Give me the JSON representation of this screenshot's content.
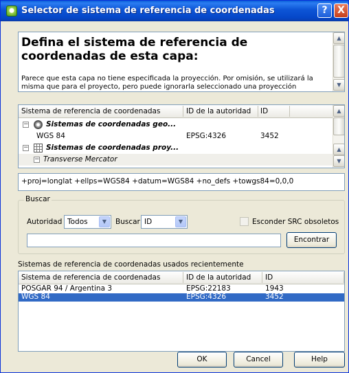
{
  "window": {
    "title": "Selector de sistema de referencia de coordenadas",
    "help_button": "?",
    "close_button": "X"
  },
  "header": {
    "title": "Defina el sistema de referencia de coordenadas de esta capa:",
    "description": "Parece que esta capa no tiene especificada la proyección. Por omisión, se utilizará la misma que para el proyecto, pero puede ignorarla seleccionado una proyección diferente a continuación."
  },
  "crs_tree": {
    "columns": [
      "Sistema de referencia de coordenadas",
      "ID de la autoridad",
      "ID"
    ],
    "rows": [
      {
        "label": "Sistemas de coordenadas geo...",
        "authority": "",
        "id": "",
        "type": "group-geo",
        "expander": "−"
      },
      {
        "label": "WGS 84",
        "authority": "EPSG:4326",
        "id": "3452",
        "type": "item"
      },
      {
        "label": "Sistemas de coordenadas proy...",
        "authority": "",
        "id": "",
        "type": "group-proj",
        "expander": "−"
      },
      {
        "label": "Transverse Mercator",
        "authority": "",
        "id": "",
        "type": "subgroup",
        "expander": "−"
      }
    ]
  },
  "proj_string": "+proj=longlat +ellps=WGS84 +datum=WGS84 +no_defs +towgs84=0,0,0",
  "search": {
    "group_title": "Buscar",
    "authority_label": "Autoridad",
    "authority_value": "Todos",
    "search_label": "Buscar",
    "search_value": "ID",
    "hide_deprecated_label": "Esconder SRC obsoletos",
    "hide_deprecated_checked": false,
    "query_value": "",
    "find_button": "Encontrar"
  },
  "recent": {
    "label": "Sistemas de referencia de coordenadas usados recientemente",
    "columns": [
      "Sistema de referencia de coordenadas",
      "ID de la autoridad",
      "ID"
    ],
    "rows": [
      {
        "name": "POSGAR 94 / Argentina 3",
        "authority": "EPSG:22183",
        "id": "1943",
        "selected": false
      },
      {
        "name": "WGS 84",
        "authority": "EPSG:4326",
        "id": "3452",
        "selected": true
      }
    ]
  },
  "buttons": {
    "ok": "OK",
    "cancel": "Cancel",
    "help": "Help"
  },
  "colors": {
    "titlebar": "#0d55d6",
    "selection": "#316ac5",
    "dialog_bg": "#ece9d8"
  }
}
